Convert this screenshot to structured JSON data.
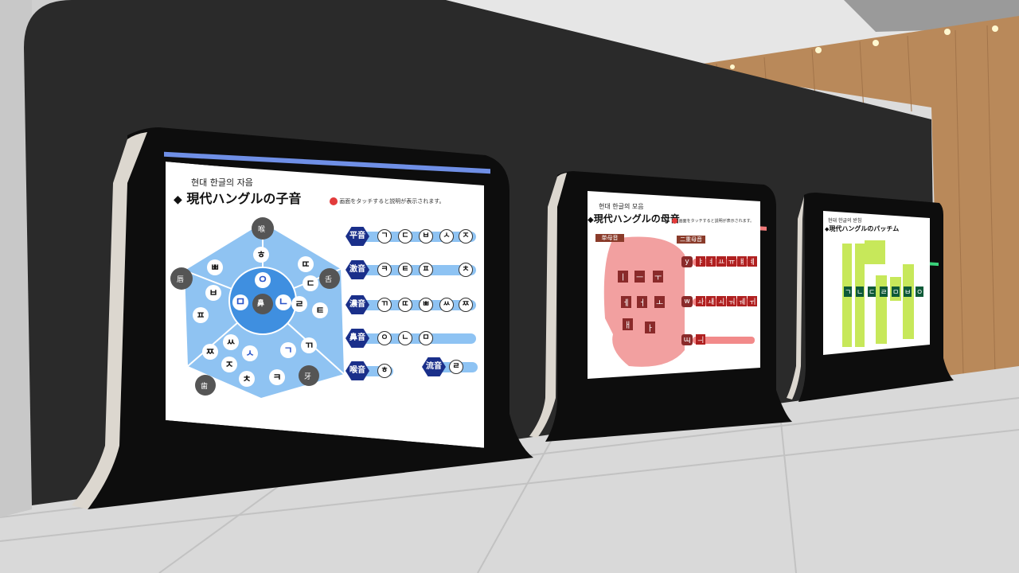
{
  "scene": {
    "wall_color": "#2a2a2a",
    "floor_color": "#d9d9d9",
    "wood_color": "#b9895a"
  },
  "panel1": {
    "accent": "#6f8fe6",
    "header_kr": "현대 한글의 자음",
    "header_jp": "現代ハングルの子音",
    "hint": "画面をタッチすると説明が表示されます。",
    "wheel_color": "#8fc3f2",
    "center_labels": [
      "ㅇ",
      "ㄴ",
      "ㅁ",
      "鼻"
    ],
    "organs": [
      "喉",
      "舌",
      "牙",
      "歯",
      "唇"
    ],
    "wheel_chars": {
      "top": [
        "ㅎ"
      ],
      "right_top": [
        "ㄸ",
        "ㄷ",
        "ㄹ",
        "ㅌ"
      ],
      "right_bottom": [
        "ㄲ",
        "ㄱ",
        "ㅋ"
      ],
      "bottom": [
        "ㅉ",
        "ㅆ",
        "ㅅ",
        "ㅈ",
        "ㅊ"
      ],
      "left": [
        "ㅃ",
        "ㅂ",
        "ㅍ"
      ]
    },
    "rows": [
      {
        "label": "平音",
        "chars": [
          "ㄱ",
          "ㄷ",
          "ㅂ",
          "ㅅ",
          "ㅈ"
        ]
      },
      {
        "label": "激音",
        "chars": [
          "ㅋ",
          "ㅌ",
          "ㅍ",
          "ㅊ"
        ]
      },
      {
        "label": "濃音",
        "chars": [
          "ㄲ",
          "ㄸ",
          "ㅃ",
          "ㅆ",
          "ㅉ"
        ]
      },
      {
        "label": "鼻音",
        "chars": [
          "ㅇ",
          "ㄴ",
          "ㅁ"
        ]
      },
      {
        "label": "喉音",
        "chars": [
          "ㅎ"
        ]
      },
      {
        "label": "流音",
        "chars": [
          "ㄹ"
        ]
      }
    ]
  },
  "panel2": {
    "accent": "#f07a7a",
    "header_kr": "현대 한글의 모음",
    "header_jp": "現代ハングルの母音",
    "hint": "画面をタッチすると説明が表示されます。",
    "tab_single": "単母音",
    "tab_double": "二重母音",
    "row_labels": [
      "y",
      "w",
      "ɰ"
    ],
    "vowels_main": [
      "ㅣ",
      "ㅡ",
      "ㅜ",
      "ㅔ",
      "ㅓ",
      "ㅗ",
      "ㅐ",
      "ㅏ"
    ],
    "y_row": [
      "ㅑ",
      "ㅕ",
      "ㅛ",
      "ㅠ",
      "ㅒ",
      "ㅖ"
    ],
    "w_row": [
      "ㅘ",
      "ㅙ",
      "ㅚ",
      "ㅝ",
      "ㅞ",
      "ㅟ"
    ],
    "ui_row": [
      "ㅢ"
    ]
  },
  "panel3": {
    "accent": "#39d27a",
    "header_kr": "현대 한글의 받침",
    "header_jp": "現代ハングルのパッチム",
    "main_chars": [
      "ㄱ",
      "ㄴ",
      "ㄷ",
      "ㄹ",
      "ㅁ",
      "ㅂ",
      "ㅇ"
    ]
  }
}
